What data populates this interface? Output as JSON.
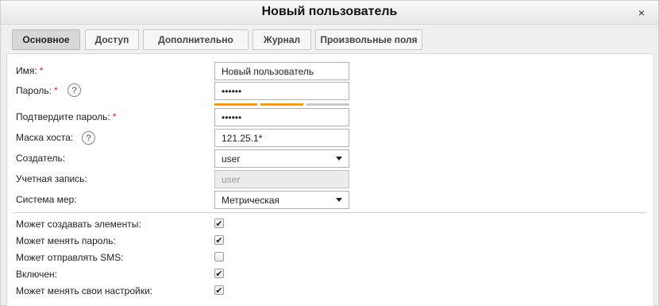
{
  "dialog": {
    "title": "Новый пользователь",
    "close_glyph": "×"
  },
  "tabs": [
    {
      "label": "Основное",
      "active": true
    },
    {
      "label": "Доступ",
      "active": false
    },
    {
      "label": "Дополнительно",
      "active": false
    },
    {
      "label": "Журнал",
      "active": false
    },
    {
      "label": "Произвольные поля",
      "active": false
    }
  ],
  "form": {
    "name": {
      "label": "Имя:",
      "required_mark": "*",
      "value": "Новый пользователь"
    },
    "password": {
      "label": "Пароль:",
      "required_mark": "*",
      "help": "?",
      "value": "••••••",
      "strength": [
        "#f39c12",
        "#f39c12",
        "#c8c8c8"
      ]
    },
    "confirm_password": {
      "label": "Подтвердите пароль:",
      "required_mark": "*",
      "value": "••••••"
    },
    "host_mask": {
      "label": "Маска хоста:",
      "help": "?",
      "value": "121.25.1*"
    },
    "creator": {
      "label": "Создатель:",
      "value": "user",
      "icon": "chevron-down-icon"
    },
    "account": {
      "label": "Учетная запись:",
      "value": "user"
    },
    "measure_system": {
      "label": "Система мер:",
      "value": "Метрическая",
      "icon": "chevron-down-icon"
    }
  },
  "permissions": [
    {
      "label": "Может создавать элементы:",
      "checked": true
    },
    {
      "label": "Может менять пароль:",
      "checked": true
    },
    {
      "label": "Может отправлять SMS:",
      "checked": false
    },
    {
      "label": "Включен:",
      "checked": true
    },
    {
      "label": "Может менять свои настройки:",
      "checked": true
    }
  ],
  "check_glyph": "✔",
  "colors": {
    "required": "#e02020",
    "strength_filled": "#f39c12",
    "strength_empty": "#c8c8c8"
  }
}
